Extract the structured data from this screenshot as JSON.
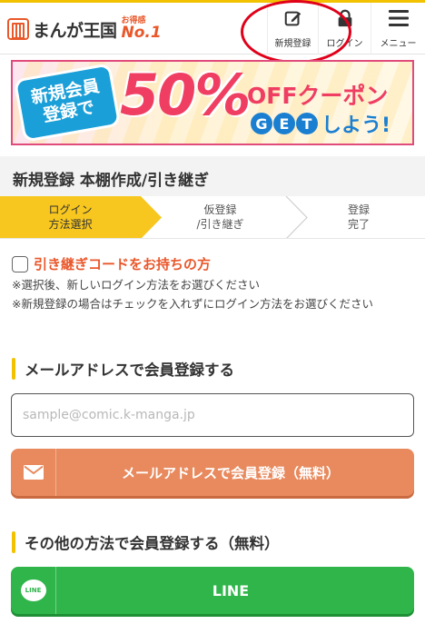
{
  "header": {
    "logo_text": "まんが王国",
    "logo_badge_top": "お得感",
    "logo_badge_bottom": "No.1",
    "signup_label": "新規登録",
    "login_label": "ログイン",
    "menu_label": "メニュー"
  },
  "banner": {
    "tag_line1": "新規会員",
    "tag_line2": "登録で",
    "percent": "50%",
    "off_text": "OFFクーポン",
    "get_letters": [
      "G",
      "E",
      "T"
    ],
    "get_rest": "しよう!"
  },
  "page": {
    "title": "新規登録 本棚作成/引き継ぎ"
  },
  "steps": [
    {
      "label": "ログイン\n方法選択",
      "active": true
    },
    {
      "label": "仮登録\n/引き継ぎ",
      "active": false
    },
    {
      "label": "登録\n完了",
      "active": false
    }
  ],
  "transfer": {
    "checkbox_label": "引き継ぎコードをお持ちの方",
    "checked": false,
    "note1": "※選択後、新しいログイン方法をお選びください",
    "note2": "※新規登録の場合はチェックを入れずにログイン方法をお選びください"
  },
  "email_section": {
    "heading": "メールアドレスで会員登録する",
    "input_placeholder": "sample@comic.k-manga.jp",
    "input_value": "",
    "button_label": "メールアドレスで会員登録（無料）"
  },
  "other_section": {
    "heading": "その他の方法で会員登録する（無料）",
    "line_button_label": "LINE",
    "line_icon_text": "LINE"
  },
  "colors": {
    "accent_yellow": "#f2c200",
    "orange": "#e9582b",
    "email_button": "#e88a5e",
    "line_green": "#2fb54a",
    "annotation_red": "#e0001a"
  }
}
